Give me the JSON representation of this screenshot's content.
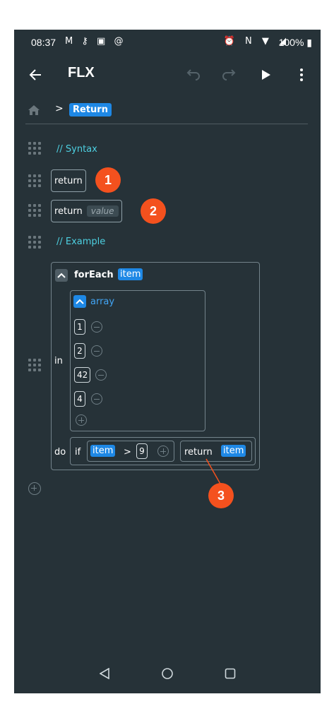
{
  "status_bar": {
    "time": "08:37",
    "left_icons": [
      "gmail-icon",
      "vpn-key-icon",
      "image-icon",
      "at-sign-icon"
    ],
    "right_icons": [
      "alarm-icon",
      "nfc-icon",
      "wifi-icon",
      "signal-icon"
    ],
    "battery": "100%"
  },
  "app_bar": {
    "title": "FLX",
    "icons": [
      "back-arrow-icon",
      "undo-icon",
      "redo-icon",
      "play-icon",
      "more-vert-icon"
    ]
  },
  "breadcrumb": {
    "home_icon": "home-icon",
    "separator": ">",
    "current": "Return"
  },
  "blocks": {
    "comment_syntax": "// Syntax",
    "return_plain": "return",
    "return_value": {
      "keyword": "return",
      "placeholder": "value"
    },
    "comment_example": "// Example",
    "foreach": {
      "keyword": "forEach",
      "variable": "item",
      "in_label": "in",
      "array_label": "array",
      "values": [
        "1",
        "2",
        "42",
        "4"
      ],
      "do_label": "do",
      "if_keyword": "if",
      "condition": {
        "left": "item",
        "operator": ">",
        "right": "9"
      },
      "return_keyword": "return",
      "return_var": "item"
    }
  },
  "callouts": [
    "1",
    "2",
    "3"
  ],
  "colors": {
    "background": "#263238",
    "accent": "#1e88e5",
    "comment": "#4dd0e1",
    "callout": "#f4511e"
  },
  "nav_bar": {
    "icons": [
      "back-triangle-icon",
      "home-circle-icon",
      "recents-square-icon"
    ]
  }
}
